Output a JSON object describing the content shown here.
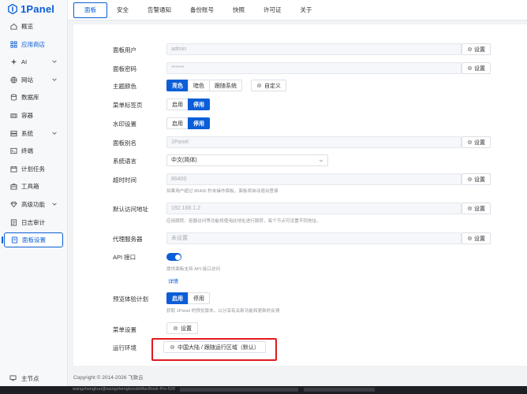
{
  "brand": {
    "name": "1Panel",
    "color": "#0b5ed7"
  },
  "sidebar": {
    "items": [
      {
        "label": "概览",
        "icon": "home-icon",
        "state": "normal",
        "arrow": false
      },
      {
        "label": "应用商店",
        "icon": "grid-icon",
        "state": "blue",
        "arrow": false
      },
      {
        "label": "AI",
        "icon": "ai-icon",
        "state": "normal",
        "arrow": true
      },
      {
        "label": "网站",
        "icon": "globe-icon",
        "state": "normal",
        "arrow": true
      },
      {
        "label": "数据库",
        "icon": "database-icon",
        "state": "normal",
        "arrow": false
      },
      {
        "label": "容器",
        "icon": "container-icon",
        "state": "normal",
        "arrow": false
      },
      {
        "label": "系统",
        "icon": "server-icon",
        "state": "normal",
        "arrow": true
      },
      {
        "label": "终端",
        "icon": "terminal-icon",
        "state": "normal",
        "arrow": false
      },
      {
        "label": "计划任务",
        "icon": "calendar-icon",
        "state": "normal",
        "arrow": false
      },
      {
        "label": "工具箱",
        "icon": "toolbox-icon",
        "state": "normal",
        "arrow": false
      },
      {
        "label": "高级功能",
        "icon": "diamond-icon",
        "state": "normal",
        "arrow": true
      },
      {
        "label": "日志审计",
        "icon": "log-icon",
        "state": "normal",
        "arrow": false
      },
      {
        "label": "面板设置",
        "icon": "settings-icon",
        "state": "active",
        "arrow": false
      }
    ],
    "bottom_label": "主节点"
  },
  "tabs": [
    "面板",
    "安全",
    "告警通知",
    "备份账号",
    "快照",
    "许可证",
    "关于"
  ],
  "settings": {
    "set_label": "设置",
    "panel_user": {
      "label": "面板用户",
      "value": "admin"
    },
    "panel_password": {
      "label": "面板密码",
      "value": "******"
    },
    "theme": {
      "label": "主题颜色",
      "options": [
        "亮色",
        "暗色",
        "跟随系统"
      ],
      "selected": "亮色",
      "custom_label": "自定义"
    },
    "menu_tabs": {
      "label": "菜单标签页",
      "options": [
        "启用",
        "停用"
      ],
      "selected": "停用"
    },
    "watermark": {
      "label": "水印设置",
      "options": [
        "启用",
        "停用"
      ],
      "selected": "停用"
    },
    "panel_alias": {
      "label": "面板别名",
      "value": "1Panel"
    },
    "language": {
      "label": "系统语言",
      "value": "中文(简体)"
    },
    "timeout": {
      "label": "超时时间",
      "value": "86400",
      "hint": "如果用户超过 86400 秒未操作面板，面板将自动退出登录"
    },
    "default_url": {
      "label": "默认访问地址",
      "value": "192.168.1.2",
      "hint": "应用跳转、容器访问等功能将使用此地址进行跳转，每个节点可设置不同地址。"
    },
    "proxy": {
      "label": "代理服务器",
      "value": "未设置"
    },
    "api": {
      "label": "API 接口",
      "enabled": true,
      "hint": "提供面板支持 API 接口访问",
      "link": "详情"
    },
    "preview": {
      "label": "预览体验计划",
      "options": [
        "启用",
        "停用"
      ],
      "selected": "启用",
      "hint": "获取 1Panel 的预览版本，以分享有关新功能和更新的反馈"
    },
    "menu_settings": {
      "label": "菜单设置",
      "button": "设置"
    },
    "runtime": {
      "label": "运行环境",
      "button": "中国大陆 / 跟随运行区域（默认）"
    }
  },
  "footer": {
    "copyright": "Copyright © 2014-2026 飞致云"
  },
  "bottom_strip": {
    "text": "wangzhengkun@wangzhengkundeMacBook-Pro-526"
  },
  "colors": {
    "accent": "#0b5ed7",
    "highlight": "#e0191f"
  }
}
